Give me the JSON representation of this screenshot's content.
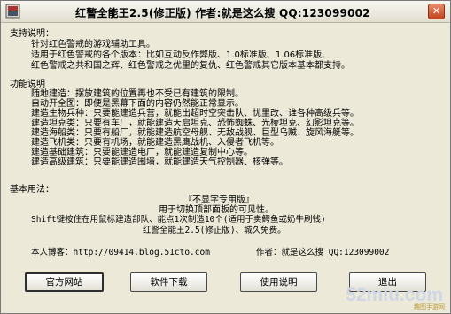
{
  "window": {
    "title": "红警全能王2.5(修正版) 作者:就是这么搜 QQ:123099002",
    "close_label": "✕"
  },
  "support": {
    "heading": "支持说明：",
    "line1": "针对红色警戒的游戏辅助工具。",
    "line2": "适用于红色警戒的各个版本：比如互动反作弊版、1.0标准版、1.06标准版、",
    "line3": "红色警戒之共和国之辉、红色警戒之优里的复仇、红色警戒其它版本基本都支持。"
  },
  "features": {
    "heading": "功能说明",
    "items": [
      "随地建造：摆放建筑的位置再也不受已有建筑的限制。",
      "自动开全图：即便是黑幕下面的内容仍然能正常显示。",
      "建造生物兵种：只要能建造兵营，就能出超时空突击队、忧里改、谁各种高级兵等。",
      "建造坦克类：只要有车厂，就能建造天启坦克、恐怖蜘蛛、光棱坦克、幻影坦克等。",
      "建造海船类：只要有船厂，就能建造航空母舰、无敌战舰、巨型乌贼、旋风海艇等。",
      "建造飞机类：只要有机场，就能建造黑鹰战机、入侵者飞机等。",
      "建造基础建筑：只要能建造电厂，就能建造复制中心等。",
      "建造高级建筑：只要能建造围墙，就能建造天气控制器、核弹等。"
    ]
  },
  "usage": {
    "heading": "基本用法：",
    "tag_line": "『不显字专用版』",
    "line1": "用于切换顶部面板的可见性。",
    "line2": "Shift键按住在用鼠标建造部队、能点1次制造10个(适用于卖鳄鱼或奶牛刷钱)",
    "line3": "红警全能王2.5(修正版)、城久免费。"
  },
  "footer": {
    "blog_label": "本人博客：http://09414.blog.51cto.com",
    "author_label": "作者：就是这么搜 QQ:123099002"
  },
  "buttons": {
    "website": "官方网站",
    "download": "软件下载",
    "help": "使用说明",
    "exit": "退出"
  },
  "watermark": {
    "text": "52miu.com",
    "sub": "趣图手游网"
  }
}
